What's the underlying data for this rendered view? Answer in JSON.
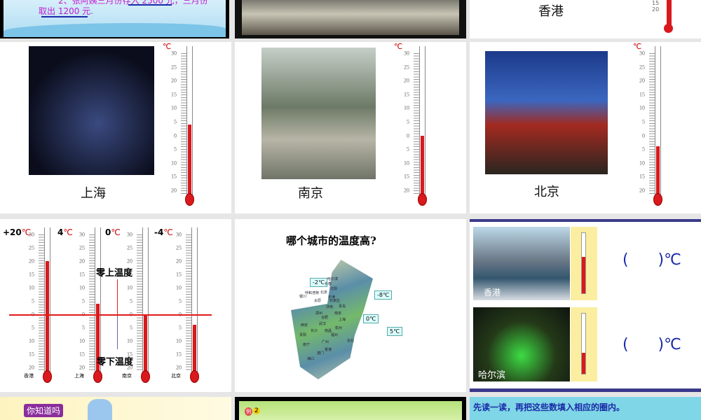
{
  "slides": [
    {
      "id": 1,
      "text_line1": "2、张阿姨三月份存入 2500 元，三月份",
      "text_line2": "取出 1200 元."
    },
    {
      "id": 2
    },
    {
      "id": 3,
      "city": "香港"
    },
    {
      "id": 4,
      "city": "上海",
      "unit": "℃",
      "reading": 4
    },
    {
      "id": 5,
      "city": "南京",
      "unit": "℃",
      "reading": 0
    },
    {
      "id": 6,
      "city": "北京",
      "unit": "℃",
      "reading": -4
    },
    {
      "id": 7,
      "readings": [
        {
          "value_label": "+20",
          "unit": "℃",
          "city": "香港",
          "reading": 20
        },
        {
          "value_label": "4",
          "unit": "℃",
          "city": "上海",
          "reading": 4
        },
        {
          "value_label": "0",
          "unit": "℃",
          "city": "南京",
          "reading": 0
        },
        {
          "value_label": "-4",
          "unit": "℃",
          "city": "北京",
          "reading": -4
        }
      ],
      "above_zero": "零上温度",
      "below_zero": "零下温度"
    },
    {
      "id": 8,
      "title": "哪个城市的温度高?",
      "callouts": [
        "-2℃",
        "-8℃",
        "0℃",
        "5℃"
      ],
      "map_labels": [
        "哈尔滨",
        "长春",
        "沈阳",
        "呼和浩特",
        "北京",
        "天津",
        "银川",
        "太原",
        "石家庄",
        "济南",
        "青岛",
        "郑州",
        "合肥",
        "南京",
        "上海",
        "武汉",
        "杭州",
        "长沙",
        "南昌",
        "福州",
        "贵阳",
        "台北",
        "南宁",
        "广州",
        "香港",
        "澳门",
        "海口",
        "西安"
      ]
    },
    {
      "id": 9,
      "rows": [
        {
          "city": "香港",
          "blank": "(      )℃",
          "reading": 17
        },
        {
          "city": "哈尔滨",
          "blank": "(      )℃",
          "reading": -12
        }
      ]
    },
    {
      "id": 10,
      "badge": "你知道吗"
    },
    {
      "id": 11,
      "badge": "例",
      "number": "2"
    },
    {
      "id": 12,
      "instruction": "先读一读，再把这些数填入相应的圈内。"
    }
  ],
  "scale_labels": [
    "30",
    "25",
    "20",
    "15",
    "10",
    "5",
    "0",
    "5",
    "10",
    "15",
    "20"
  ],
  "colors": {
    "mercury": "#d9191c",
    "blank_text": "#1a2aa8",
    "frame_blue": "#3a3a8c"
  }
}
